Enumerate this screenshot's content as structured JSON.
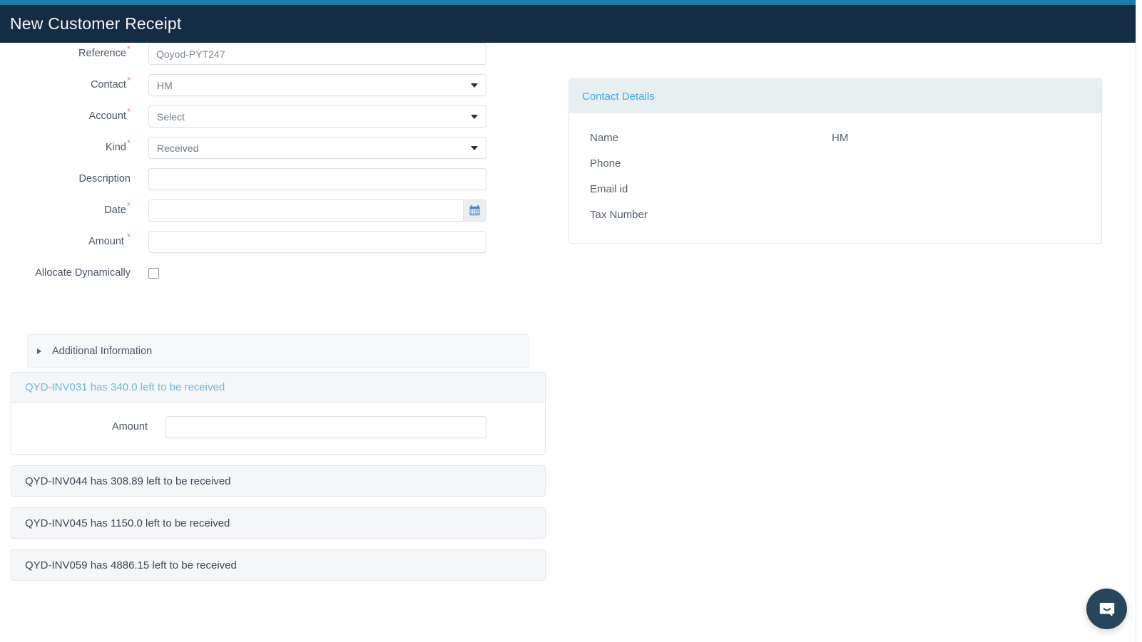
{
  "header": {
    "title": "New Customer Receipt",
    "accent_color": "#1b7ba8",
    "bar_color": "#152d42"
  },
  "form": {
    "fields": [
      {
        "label": "Reference",
        "required": true,
        "type": "text",
        "value": "Qoyod-PYT247",
        "placeholder": ""
      },
      {
        "label": "Contact",
        "required": true,
        "type": "select",
        "value": "HM"
      },
      {
        "label": "Account",
        "required": true,
        "type": "select",
        "value": "Select"
      },
      {
        "label": "Kind",
        "required": true,
        "type": "select",
        "value": "Received"
      },
      {
        "label": "Description",
        "required": false,
        "type": "text",
        "value": "",
        "placeholder": ""
      },
      {
        "label": "Date",
        "required": true,
        "type": "date",
        "value": "",
        "placeholder": ""
      },
      {
        "label": "Amount",
        "required": true,
        "type": "text",
        "value": "",
        "placeholder": ""
      },
      {
        "label": "Allocate Dynamically",
        "required": false,
        "type": "checkbox",
        "checked": false
      }
    ],
    "reference_label": "Reference",
    "contact_label": "Contact",
    "account_label": "Account",
    "kind_label": "Kind",
    "description_label": "Description",
    "date_label": "Date",
    "amount_label": "Amount",
    "allocate_label": "Allocate Dynamically",
    "reference_value": "Qoyod-PYT247",
    "contact_value": "HM",
    "account_value": "Select",
    "kind_value": "Received",
    "description_value": "",
    "date_value": "",
    "amount_value": "",
    "calendar_icon": "calendar-icon",
    "caret_icon": "chevron-down-icon",
    "required_marker": "*"
  },
  "additional_information": {
    "label": "Additional Information",
    "expanded": false,
    "arrow_icon": "triangle-right-icon"
  },
  "invoices": {
    "amount_label": "Amount",
    "items": [
      {
        "title": "QYD-INV031 has 340.0 left to be received",
        "code": "QYD-INV031",
        "remaining": "340.0",
        "expanded": true,
        "amount_value": ""
      },
      {
        "title": "QYD-INV044 has 308.89 left to be received",
        "code": "QYD-INV044",
        "remaining": "308.89",
        "expanded": false
      },
      {
        "title": "QYD-INV045 has 1150.0 left to be received",
        "code": "QYD-INV045",
        "remaining": "1150.0",
        "expanded": false
      },
      {
        "title": "QYD-INV059 has 4886.15 left to be received",
        "code": "QYD-INV059",
        "remaining": "4886.15",
        "expanded": false
      }
    ]
  },
  "contact_details": {
    "title": "Contact Details",
    "rows": [
      {
        "key": "Name",
        "value": "HM"
      },
      {
        "key": "Phone",
        "value": ""
      },
      {
        "key": "Email id",
        "value": ""
      },
      {
        "key": "Tax Number",
        "value": ""
      }
    ]
  },
  "chat": {
    "icon": "chat-bubble-smile-icon",
    "color": "#27465c"
  }
}
